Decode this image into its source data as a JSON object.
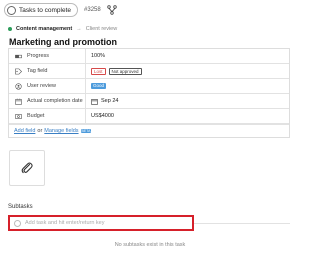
{
  "header": {
    "status_label": "Tasks to complete",
    "task_id": "#3258"
  },
  "breadcrumb": {
    "project": "Content management",
    "separator": "→",
    "status": "Client review"
  },
  "task": {
    "title": "Marketing and promotion"
  },
  "fields": [
    {
      "label": "Progress",
      "icon": "progress-icon",
      "value": "100%"
    },
    {
      "label": "Tag field",
      "icon": "tag-icon",
      "tags": [
        "Lost",
        "Not approved"
      ]
    },
    {
      "label": "User review",
      "icon": "review-icon",
      "badge": "Good"
    },
    {
      "label": "Actual completion date",
      "icon": "calendar-icon",
      "value": "Sep 24"
    },
    {
      "label": "Budget",
      "icon": "budget-icon",
      "value": "US$4000"
    }
  ],
  "field_links": {
    "add_field": "Add field",
    "or": "or",
    "manage_fields": "Manage fields",
    "beta": "BETA"
  },
  "subtasks": {
    "title": "Subtasks",
    "input_placeholder": "Add task and hit enter/return key",
    "empty_text": "No subtasks exist in this task"
  },
  "colors": {
    "accent": "#3a7fc4",
    "highlight": "#d6202a",
    "project_dot": "#2c9c5a",
    "lost_tag": "#d64a4a",
    "good_badge": "#4d9bdc"
  }
}
